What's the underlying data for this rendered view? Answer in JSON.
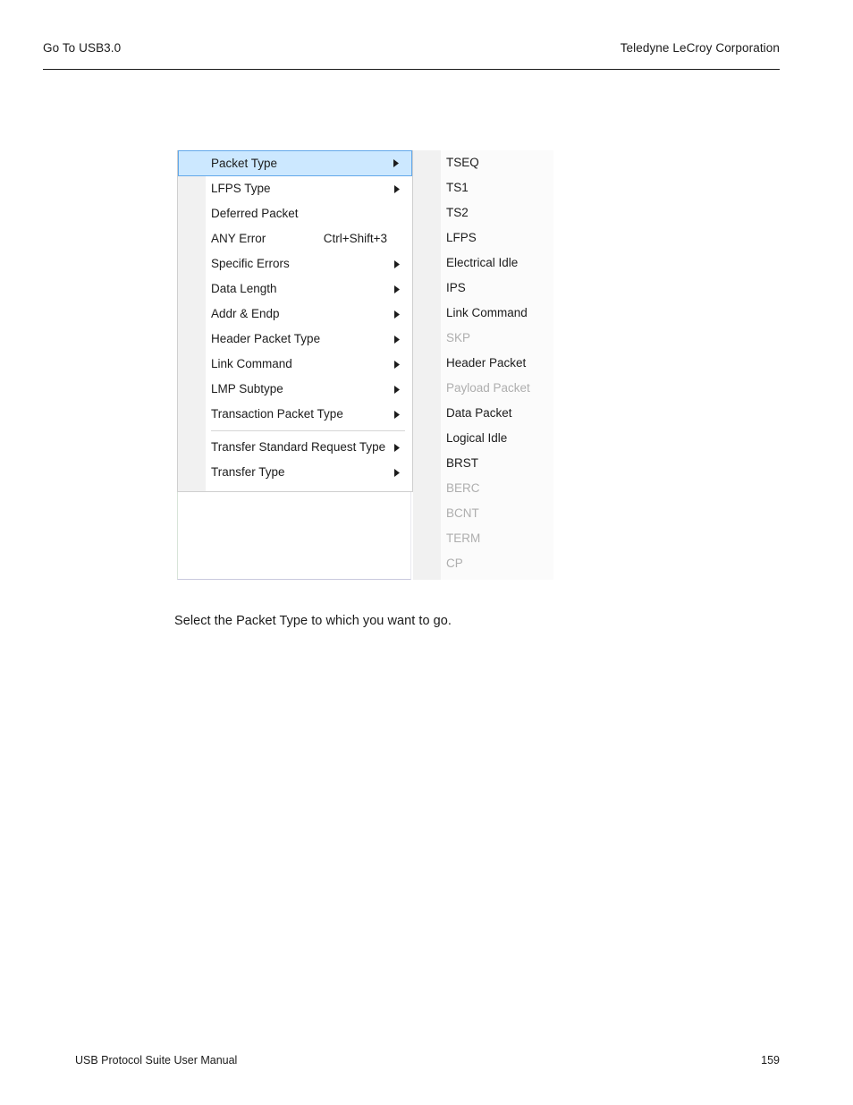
{
  "header": {
    "left": "Go To USB3.0",
    "right": "Teledyne LeCroy Corporation"
  },
  "footer": {
    "left": "USB Protocol Suite User Manual",
    "page_number": "159"
  },
  "body": {
    "paragraph": "Select the Packet Type to which you want to go."
  },
  "colors": {
    "selection_background": "#cce8ff",
    "selection_border": "#62a8ea",
    "menu_background": "#ffffff",
    "submenu_background": "#fbfbfb",
    "gutter": "#f1f1f1",
    "disabled_text": "#aeaeae",
    "text": "#1c1c1c"
  },
  "context_menu": {
    "name": "go-to-usb3-context-menu",
    "items": [
      {
        "label": "Packet Type",
        "shortcut": "",
        "has_submenu": true,
        "selected": true,
        "disabled": false,
        "separator_after": false
      },
      {
        "label": "LFPS Type",
        "shortcut": "",
        "has_submenu": true,
        "selected": false,
        "disabled": false,
        "separator_after": false
      },
      {
        "label": "Deferred Packet",
        "shortcut": "",
        "has_submenu": false,
        "selected": false,
        "disabled": false,
        "separator_after": false
      },
      {
        "label": "ANY Error",
        "shortcut": "Ctrl+Shift+3",
        "has_submenu": false,
        "selected": false,
        "disabled": false,
        "separator_after": false
      },
      {
        "label": "Specific Errors",
        "shortcut": "",
        "has_submenu": true,
        "selected": false,
        "disabled": false,
        "separator_after": false
      },
      {
        "label": "Data Length",
        "shortcut": "",
        "has_submenu": true,
        "selected": false,
        "disabled": false,
        "separator_after": false
      },
      {
        "label": "Addr & Endp",
        "shortcut": "",
        "has_submenu": true,
        "selected": false,
        "disabled": false,
        "separator_after": false
      },
      {
        "label": "Header Packet Type",
        "shortcut": "",
        "has_submenu": true,
        "selected": false,
        "disabled": false,
        "separator_after": false
      },
      {
        "label": "Link Command",
        "shortcut": "",
        "has_submenu": true,
        "selected": false,
        "disabled": false,
        "separator_after": false
      },
      {
        "label": "LMP Subtype",
        "shortcut": "",
        "has_submenu": true,
        "selected": false,
        "disabled": false,
        "separator_after": false
      },
      {
        "label": "Transaction Packet Type",
        "shortcut": "",
        "has_submenu": true,
        "selected": false,
        "disabled": false,
        "separator_after": true
      },
      {
        "label": "Transfer Standard Request Type",
        "shortcut": "",
        "has_submenu": true,
        "selected": false,
        "disabled": false,
        "separator_after": false
      },
      {
        "label": "Transfer Type",
        "shortcut": "",
        "has_submenu": true,
        "selected": false,
        "disabled": false,
        "separator_after": false
      }
    ]
  },
  "submenu": {
    "name": "packet-type-submenu",
    "parent": "Packet Type",
    "items": [
      {
        "label": "TSEQ",
        "disabled": false
      },
      {
        "label": "TS1",
        "disabled": false
      },
      {
        "label": "TS2",
        "disabled": false
      },
      {
        "label": "LFPS",
        "disabled": false
      },
      {
        "label": "Electrical Idle",
        "disabled": false
      },
      {
        "label": "IPS",
        "disabled": false
      },
      {
        "label": "Link Command",
        "disabled": false
      },
      {
        "label": "SKP",
        "disabled": true
      },
      {
        "label": "Header Packet",
        "disabled": false
      },
      {
        "label": "Payload Packet",
        "disabled": true
      },
      {
        "label": "Data Packet",
        "disabled": false
      },
      {
        "label": "Logical Idle",
        "disabled": false
      },
      {
        "label": "BRST",
        "disabled": false
      },
      {
        "label": "BERC",
        "disabled": true
      },
      {
        "label": "BCNT",
        "disabled": true
      },
      {
        "label": "TERM",
        "disabled": true
      },
      {
        "label": "CP",
        "disabled": true
      }
    ]
  }
}
